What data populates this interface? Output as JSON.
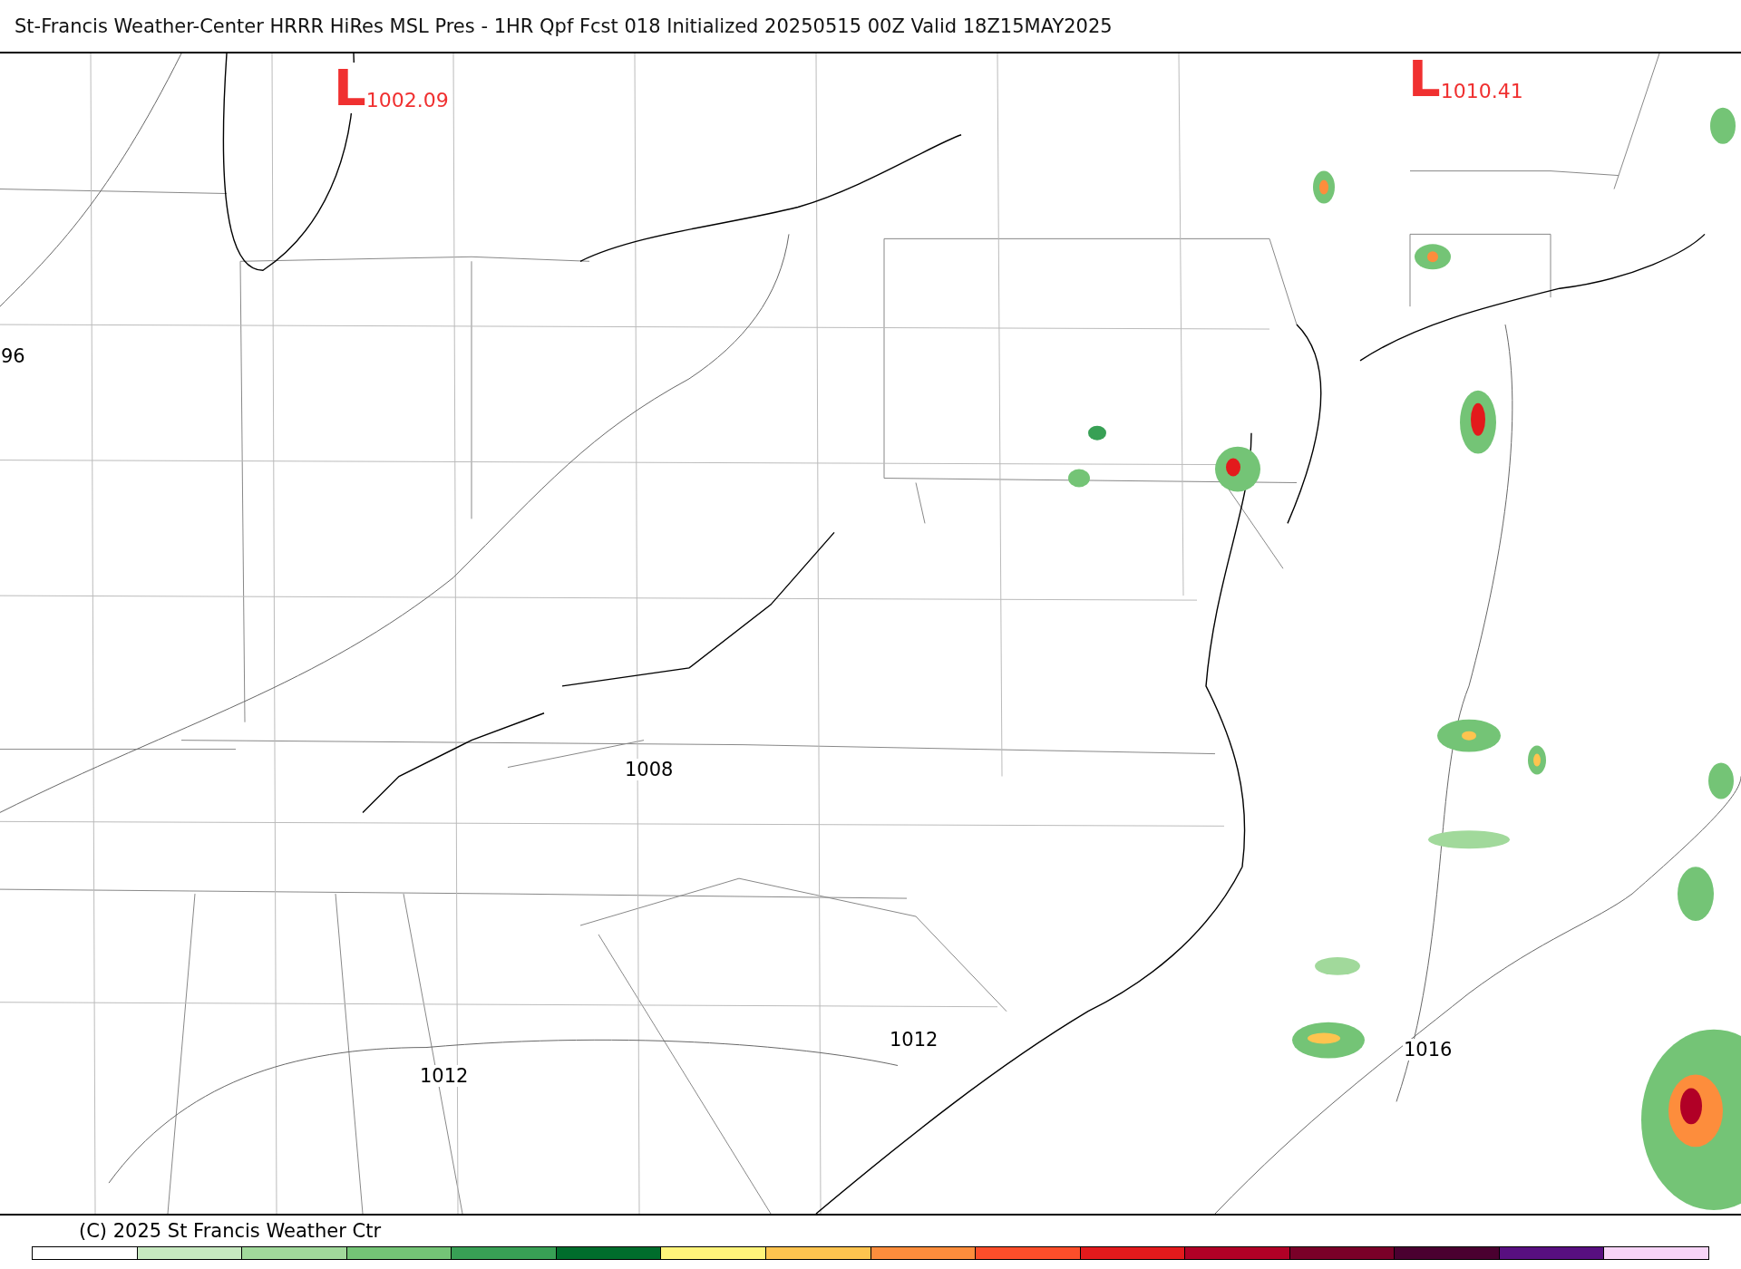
{
  "title": "St-Francis Weather-Center HRRR HiRes MSL Pres - 1HR Qpf Fcst 018 Initialized 20250515 00Z Valid 18Z15MAY2025",
  "map": {
    "lows": [
      {
        "symbol": "L",
        "value": "1002.09"
      },
      {
        "symbol": "L",
        "value": "1010.41"
      }
    ],
    "isobar_labels": [
      "96",
      "1008",
      "1012",
      "1012",
      "1016"
    ]
  },
  "copyright": "(C) 2025 St Francis Weather Ctr",
  "colorbar": [
    {
      "color": "#ffffff"
    },
    {
      "color": "#c7e9c0"
    },
    {
      "color": "#a1d99b"
    },
    {
      "color": "#74c476"
    },
    {
      "color": "#38a055"
    },
    {
      "color": "#006d2c"
    },
    {
      "color": "#fff47a"
    },
    {
      "color": "#fec44f"
    },
    {
      "color": "#fd8d3c"
    },
    {
      "color": "#fc4e2a"
    },
    {
      "color": "#e31a1c"
    },
    {
      "color": "#b10026"
    },
    {
      "color": "#7a0028"
    },
    {
      "color": "#4a0030"
    },
    {
      "color": "#580f80"
    },
    {
      "color": "#f7d4f7"
    }
  ]
}
